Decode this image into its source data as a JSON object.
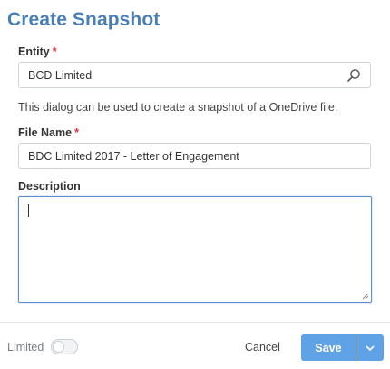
{
  "dialog": {
    "title": "Create Snapshot",
    "entity": {
      "label": "Entity",
      "required_mark": "*",
      "value": "BCD Limited",
      "icon": "search-icon"
    },
    "help_text": "This dialog can be used to create a snapshot of a OneDrive file.",
    "file_name": {
      "label": "File Name",
      "required_mark": "*",
      "value": "BDC Limited 2017 - Letter of Engagement"
    },
    "description": {
      "label": "Description",
      "value": ""
    },
    "footer": {
      "limited_label": "Limited",
      "limited_on": false,
      "cancel_label": "Cancel",
      "save_label": "Save",
      "save_dropdown_icon": "chevron-down-icon"
    }
  },
  "colors": {
    "title": "#4a7fb5",
    "required": "#d9363e",
    "primary": "#5fa3e6",
    "focus_border": "#5b8fd0"
  }
}
